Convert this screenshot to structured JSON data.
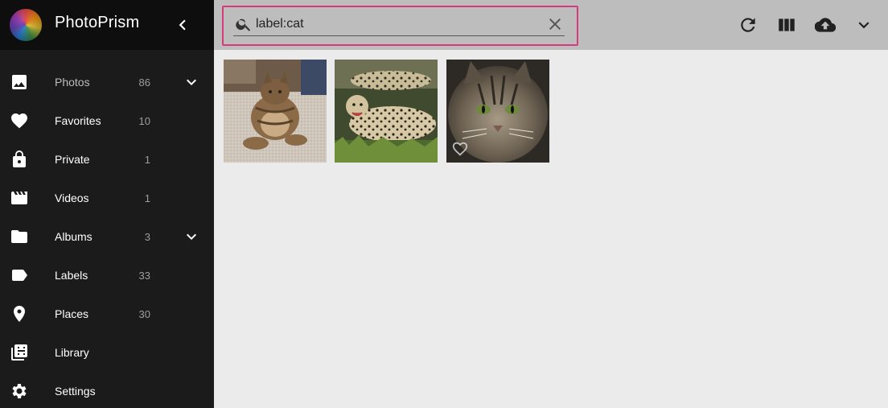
{
  "app": {
    "title": "PhotoPrism"
  },
  "nav": {
    "items": [
      {
        "label": "Photos",
        "count": "86",
        "icon": "image-icon",
        "expandable": true
      },
      {
        "label": "Favorites",
        "count": "10",
        "icon": "heart-icon",
        "expandable": false
      },
      {
        "label": "Private",
        "count": "1",
        "icon": "lock-icon",
        "expandable": false
      },
      {
        "label": "Videos",
        "count": "1",
        "icon": "movie-icon",
        "expandable": false
      },
      {
        "label": "Albums",
        "count": "3",
        "icon": "folder-icon",
        "expandable": true
      },
      {
        "label": "Labels",
        "count": "33",
        "icon": "label-icon",
        "expandable": false
      },
      {
        "label": "Places",
        "count": "30",
        "icon": "map-marker-icon",
        "expandable": false
      },
      {
        "label": "Library",
        "count": "",
        "icon": "film-library-icon",
        "expandable": false
      },
      {
        "label": "Settings",
        "count": "",
        "icon": "gear-icon",
        "expandable": false
      }
    ]
  },
  "search": {
    "value": "label:cat",
    "placeholder": "Search"
  },
  "colors": {
    "sidebar": "#1b1b1b",
    "brand_bar": "#0e0e0e",
    "toolbar": "#bdbdbd",
    "search_highlight": "#d63a7b",
    "content_bg": "#ebebeb"
  },
  "toolbar": {
    "icons": [
      "refresh-icon",
      "view-column-icon",
      "cloud-upload-icon",
      "chevron-down-icon"
    ]
  },
  "photos": [
    {
      "subject": "tabby cat sitting on carpet"
    },
    {
      "subject": "cheetahs lying on grass"
    },
    {
      "subject": "long-haired tabby cat face",
      "favorite_icon": "heart-outline-icon"
    }
  ]
}
